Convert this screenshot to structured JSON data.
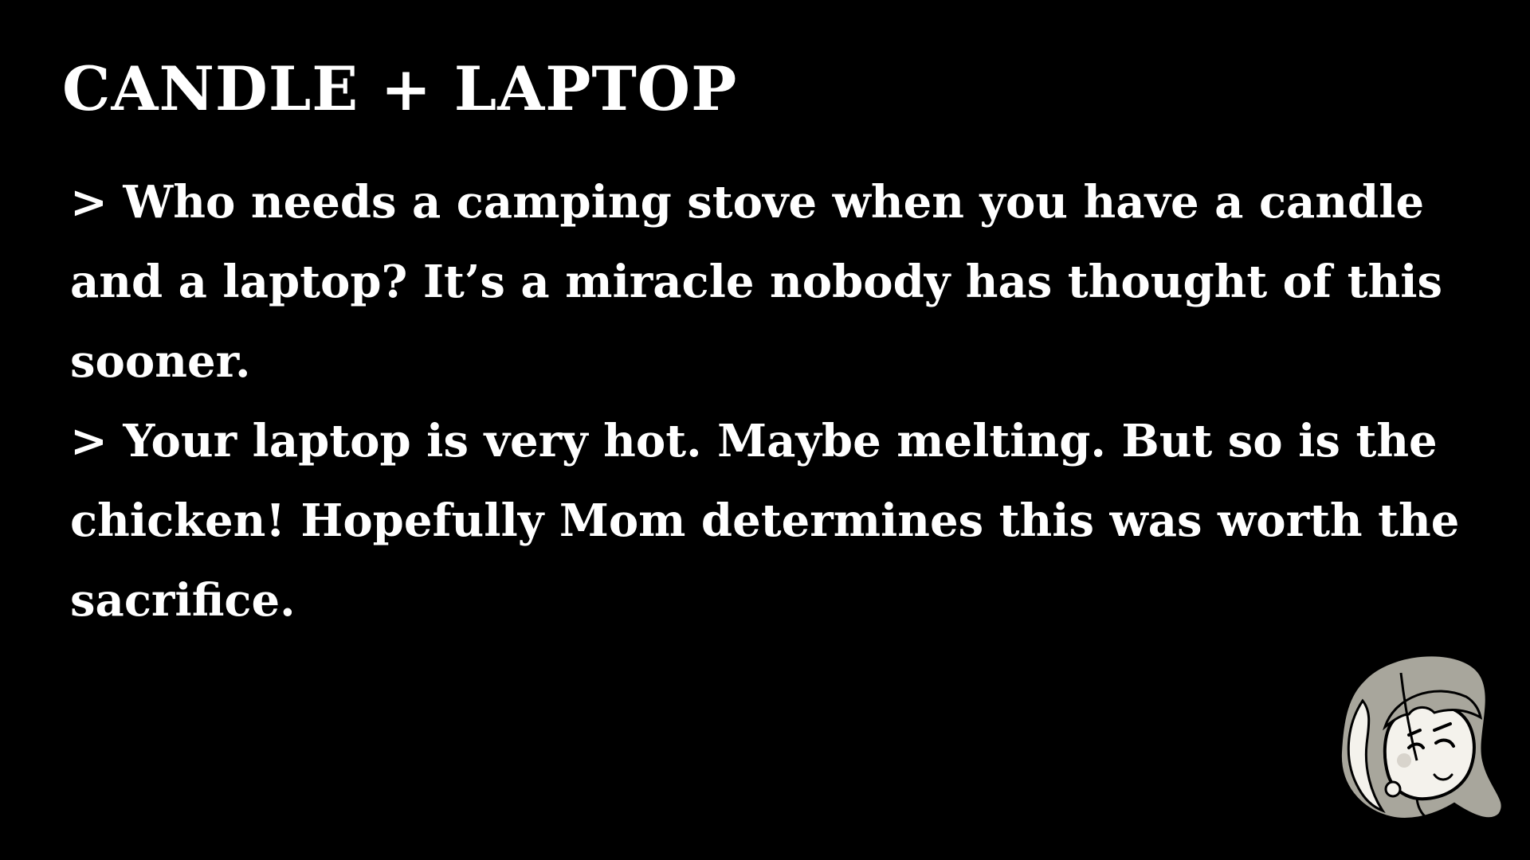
{
  "title": "CANDLE + LAPTOP",
  "log": [
    {
      "text": "> Who needs a camping stove when you have a candle and a laptop? It’s a miracle nobody has thought of this sooner."
    },
    {
      "text": "> Your laptop is very hot. Maybe melting. But so is the chicken! Hopefully Mom determines this was worth the sacrifice."
    }
  ],
  "portrait": {
    "icon": "character-face-icon"
  },
  "colors": {
    "background": "#000000",
    "text": "#ffffff",
    "hair": "#a8a69c",
    "skin": "#f4f2ec",
    "outline": "#000000"
  }
}
